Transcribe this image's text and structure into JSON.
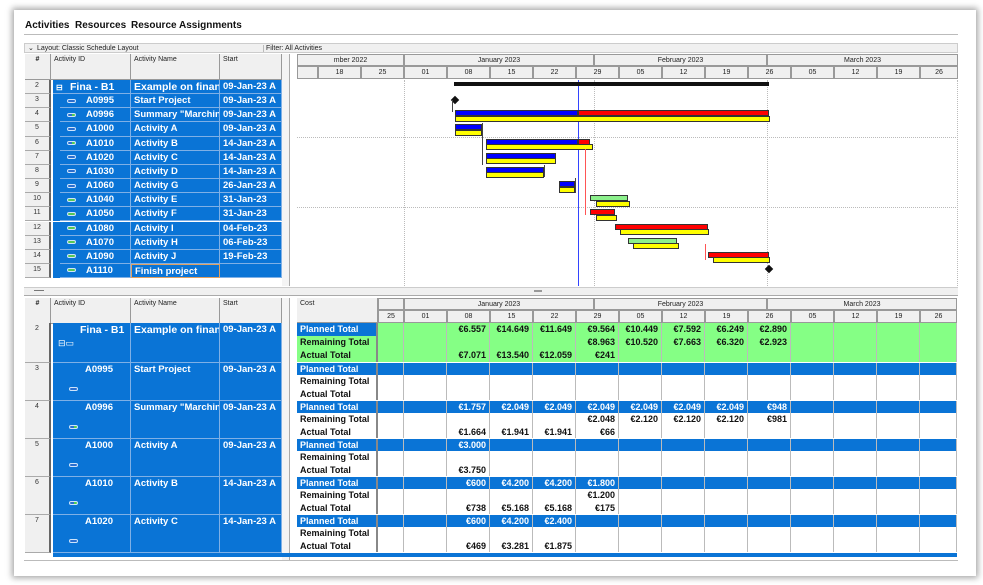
{
  "tabs": [
    "Activities",
    "Resources",
    "Resource Assignments"
  ],
  "layout_label": "Layout: Classic Schedule Layout",
  "filter_label": "Filter: All Activities",
  "columns": {
    "num": "#",
    "id": "Activity ID",
    "name": "Activity Name",
    "start": "Start",
    "cost": "Cost"
  },
  "colors": {
    "row_blue": "#0a74d6",
    "green_band": "#85ff85",
    "actual_bar": "#0000ff",
    "remaining_bar": "#ff0000",
    "baseline_bar": "#ffff00",
    "not_started_bar": "#8cf08c",
    "data_date_line": "#3344ff"
  },
  "timescale": {
    "months_top": [
      "mber 2022",
      "January 2023",
      "February 2023",
      "March 2023"
    ],
    "weeks_top": [
      "",
      "18",
      "25",
      "01",
      "08",
      "15",
      "22",
      "29",
      "05",
      "12",
      "19",
      "26",
      "05",
      "12",
      "19",
      "26"
    ],
    "months_bottom": [
      "January 2023",
      "February 2023",
      "March 2023"
    ],
    "weeks_bottom": [
      "25",
      "01",
      "08",
      "15",
      "22",
      "29",
      "05",
      "12",
      "19",
      "26",
      "05",
      "12",
      "19",
      "26"
    ]
  },
  "activities": [
    {
      "num": "2",
      "id": "Fina - B1",
      "name": "Example on financ",
      "start": "09-Jan-23 A",
      "icon": "folder-icon"
    },
    {
      "num": "3",
      "id": "A0995",
      "name": "Start Project",
      "start": "09-Jan-23 A",
      "icon": "in-progress-icon"
    },
    {
      "num": "4",
      "id": "A0996",
      "name": "Summary \"Marching",
      "start": "09-Jan-23 A",
      "icon": "level-of-effort-icon"
    },
    {
      "num": "5",
      "id": "A1000",
      "name": "Activity A",
      "start": "09-Jan-23 A",
      "icon": "in-progress-icon"
    },
    {
      "num": "6",
      "id": "A1010",
      "name": "Activity B",
      "start": "14-Jan-23 A",
      "icon": "level-of-effort-icon"
    },
    {
      "num": "7",
      "id": "A1020",
      "name": "Activity C",
      "start": "14-Jan-23 A",
      "icon": "in-progress-icon"
    },
    {
      "num": "8",
      "id": "A1030",
      "name": "Activity D",
      "start": "14-Jan-23 A",
      "icon": "in-progress-icon"
    },
    {
      "num": "9",
      "id": "A1060",
      "name": "Activity G",
      "start": "26-Jan-23 A",
      "icon": "in-progress-icon"
    },
    {
      "num": "10",
      "id": "A1040",
      "name": "Activity E",
      "start": "31-Jan-23",
      "icon": "not-started-icon"
    },
    {
      "num": "11",
      "id": "A1050",
      "name": "Activity F",
      "start": "31-Jan-23",
      "icon": "not-started-icon"
    },
    {
      "num": "12",
      "id": "A1080",
      "name": "Activity I",
      "start": "04-Feb-23",
      "icon": "not-started-icon"
    },
    {
      "num": "13",
      "id": "A1070",
      "name": "Activity H",
      "start": "06-Feb-23",
      "icon": "not-started-icon"
    },
    {
      "num": "14",
      "id": "A1090",
      "name": "Activity J",
      "start": "19-Feb-23",
      "icon": "not-started-icon"
    },
    {
      "num": "15",
      "id": "A1110",
      "name": "Finish project",
      "start": "",
      "icon": "not-started-icon"
    }
  ],
  "cost_labels": [
    "Planned Total",
    "Remaining Total",
    "Actual Total"
  ],
  "cost_rows": [
    {
      "planned": [
        "",
        "",
        "€6.557",
        "€14.649",
        "€11.649",
        "€9.564",
        "€10.449",
        "€7.592",
        "€6.249",
        "€2.890",
        "",
        "",
        "",
        ""
      ],
      "remaining": [
        "",
        "",
        "",
        "",
        "",
        "€8.963",
        "€10.520",
        "€7.663",
        "€6.320",
        "€2.923",
        "",
        "",
        "",
        ""
      ],
      "actual": [
        "",
        "",
        "€7.071",
        "€13.540",
        "€12.059",
        "€241",
        "",
        "",
        "",
        "",
        "",
        "",
        "",
        ""
      ]
    },
    {
      "planned": [
        "",
        "",
        "",
        "",
        "",
        "",
        "",
        "",
        "",
        "",
        "",
        "",
        "",
        ""
      ],
      "remaining": [
        "",
        "",
        "",
        "",
        "",
        "",
        "",
        "",
        "",
        "",
        "",
        "",
        "",
        ""
      ],
      "actual": [
        "",
        "",
        "",
        "",
        "",
        "",
        "",
        "",
        "",
        "",
        "",
        "",
        "",
        ""
      ]
    },
    {
      "planned": [
        "",
        "",
        "€1.757",
        "€2.049",
        "€2.049",
        "€2.049",
        "€2.049",
        "€2.049",
        "€2.049",
        "€948",
        "",
        "",
        "",
        ""
      ],
      "remaining": [
        "",
        "",
        "",
        "",
        "",
        "€2.048",
        "€2.120",
        "€2.120",
        "€2.120",
        "€981",
        "",
        "",
        "",
        ""
      ],
      "actual": [
        "",
        "",
        "€1.664",
        "€1.941",
        "€1.941",
        "€66",
        "",
        "",
        "",
        "",
        "",
        "",
        "",
        ""
      ]
    },
    {
      "planned": [
        "",
        "",
        "€3.000",
        "",
        "",
        "",
        "",
        "",
        "",
        "",
        "",
        "",
        "",
        ""
      ],
      "remaining": [
        "",
        "",
        "",
        "",
        "",
        "",
        "",
        "",
        "",
        "",
        "",
        "",
        "",
        ""
      ],
      "actual": [
        "",
        "",
        "€3.750",
        "",
        "",
        "",
        "",
        "",
        "",
        "",
        "",
        "",
        "",
        ""
      ]
    },
    {
      "planned": [
        "",
        "",
        "€600",
        "€4.200",
        "€4.200",
        "€1.800",
        "",
        "",
        "",
        "",
        "",
        "",
        "",
        ""
      ],
      "remaining": [
        "",
        "",
        "",
        "",
        "",
        "€1.200",
        "",
        "",
        "",
        "",
        "",
        "",
        "",
        ""
      ],
      "actual": [
        "",
        "",
        "€738",
        "€5.168",
        "€5.168",
        "€175",
        "",
        "",
        "",
        "",
        "",
        "",
        "",
        ""
      ]
    },
    {
      "planned": [
        "",
        "",
        "€600",
        "€4.200",
        "€2.400",
        "",
        "",
        "",
        "",
        "",
        "",
        "",
        "",
        ""
      ],
      "remaining": [
        "",
        "",
        "",
        "",
        "",
        "",
        "",
        "",
        "",
        "",
        "",
        "",
        "",
        ""
      ],
      "actual": [
        "",
        "",
        "€469",
        "€3.281",
        "€1.875",
        "",
        "",
        "",
        "",
        "",
        "",
        "",
        "",
        ""
      ]
    }
  ]
}
